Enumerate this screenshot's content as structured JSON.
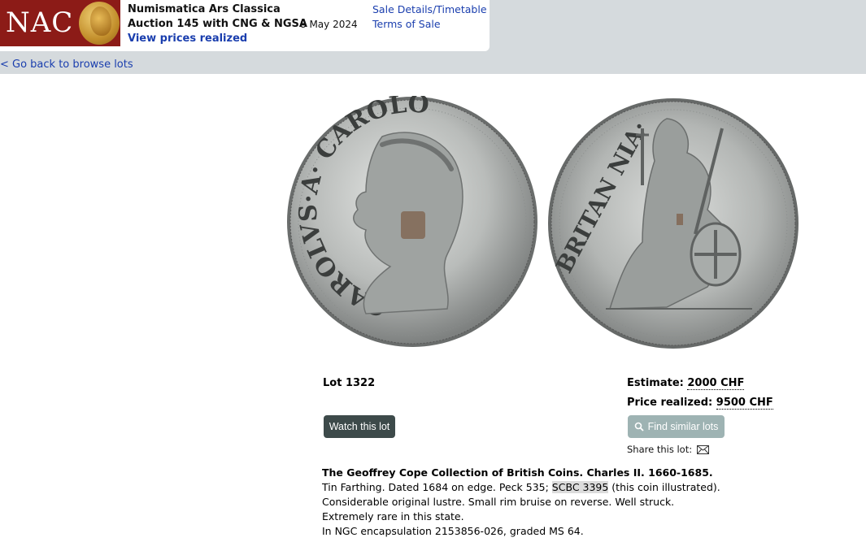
{
  "header": {
    "logo_text": "NAC",
    "title": "Numismatica Ars Classica",
    "auction": "Auction 145 with CNG & NGSA",
    "date": "8 May 2024",
    "view_prices": "View prices realized",
    "sale_details": "Sale Details/Timetable",
    "terms": "Terms of Sale"
  },
  "nav": {
    "back": "< Go back to browse lots"
  },
  "coin": {
    "obverse_legend": "CAROLVS·A· CAROLO",
    "reverse_legend": "BRITAN NIA·"
  },
  "lot": {
    "label": "Lot 1322",
    "estimate_label": "Estimate:",
    "estimate_value": "2000 CHF",
    "price_label": "Price realized:",
    "price_value": "9500 CHF",
    "watch_button": "Watch this lot",
    "similar_button": "Find similar lots",
    "share_label": "Share this lot:",
    "icons": {
      "similar": "magnifier-icon",
      "share": "envelope-icon"
    }
  },
  "description": {
    "title": "The Geoffrey Cope Collection of British Coins. Charles II. 1660-1685.",
    "line1_before": "Tin Farthing. Dated 1684 on edge. Peck 535; ",
    "line1_highlight": "SCBC 3395",
    "line1_after": " (this coin illustrated).",
    "line2": "Considerable original lustre. Small rim bruise on reverse. Well struck.",
    "line3": "Extremely rare in this state.",
    "line4": "In NGC encapsulation 2153856-026, graded MS 64."
  },
  "colors": {
    "header_bg": "#d5dadd",
    "logo_red": "#8c1b17",
    "link_blue": "#1a3eae",
    "watch_btn": "#3d4a4a",
    "similar_btn": "#9eb3b3"
  }
}
